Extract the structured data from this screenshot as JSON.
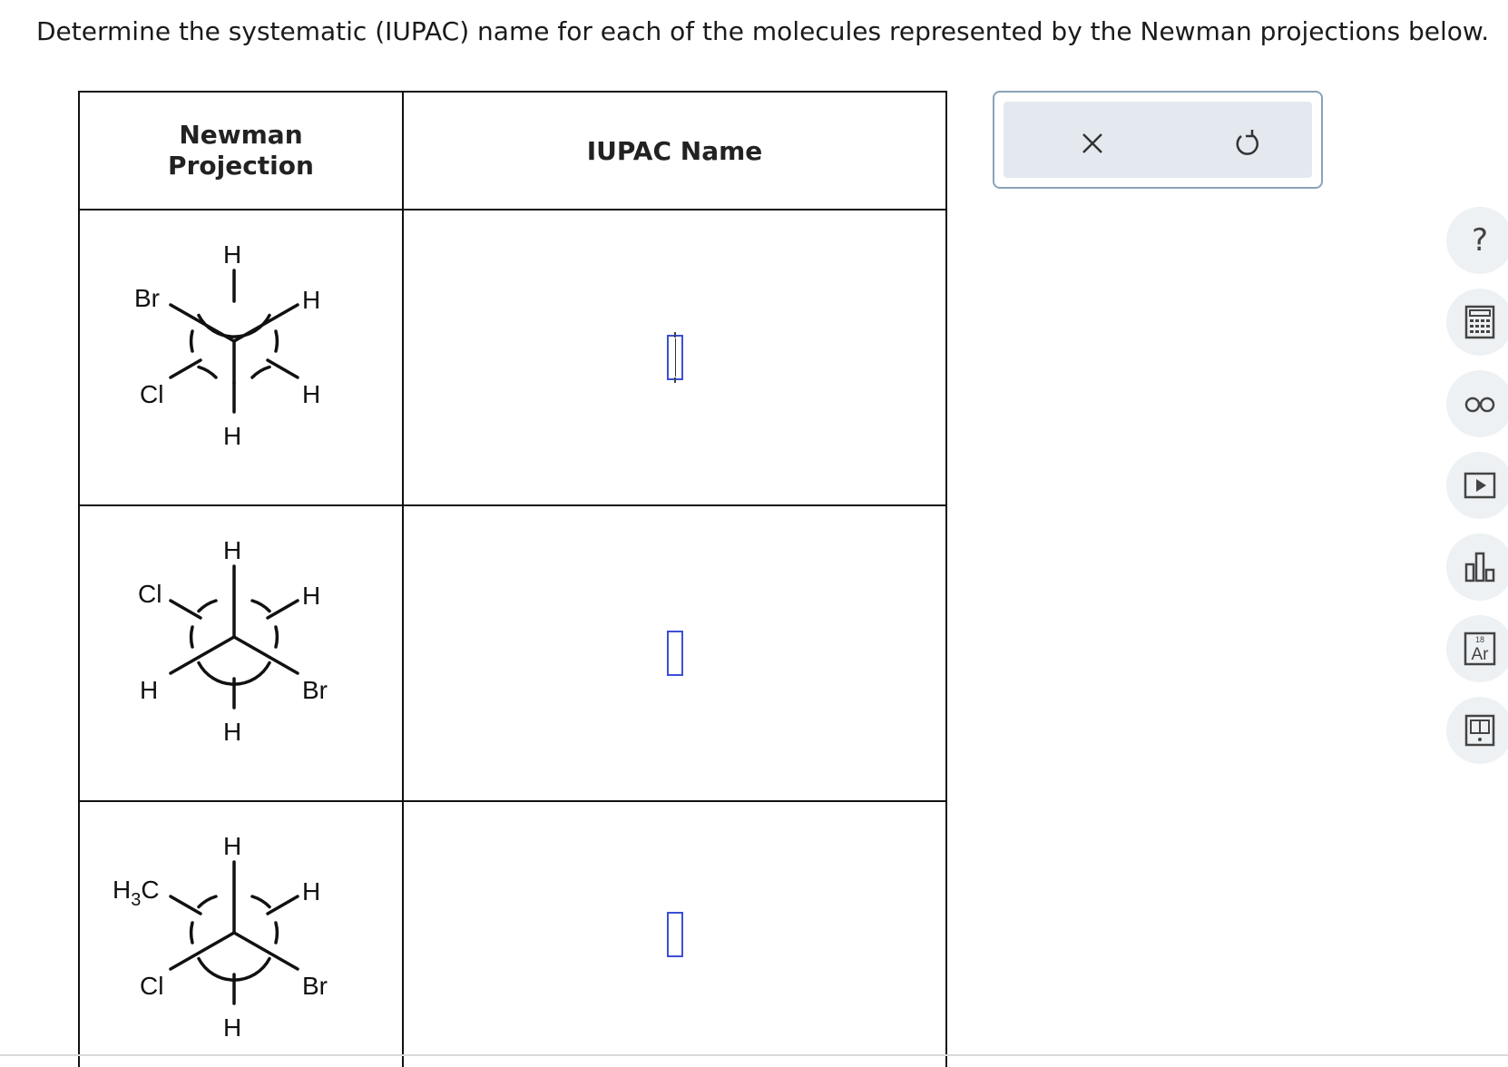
{
  "prompt": "Determine the systematic (IUPAC) name for each of the molecules represented by the Newman projections below.",
  "table": {
    "col1_header_line1": "Newman",
    "col1_header_line2": "Projection",
    "col2_header": "IUPAC Name",
    "rows": [
      {
        "front_top": "H",
        "front_bottom_left": "Cl",
        "front_bottom_right": "H",
        "back_top_left": "Br",
        "back_top_right": "H",
        "back_bottom": "H",
        "name_value": ""
      },
      {
        "front_top": "H",
        "front_bottom_left": "H",
        "front_bottom_right": "Br",
        "back_top_left": "Cl",
        "back_top_right": "H",
        "back_bottom": "H",
        "name_value": ""
      },
      {
        "front_top": "H",
        "front_bottom_left": "Cl",
        "front_bottom_right": "Br",
        "back_top_left_main": "H",
        "back_top_left_sub": "3",
        "back_top_left_tail": "C",
        "back_top_right": "H",
        "back_bottom": "H",
        "name_value": ""
      }
    ]
  },
  "answer_panel": {
    "clear_icon": "close-x-icon",
    "undo_icon": "undo-arrow-icon"
  },
  "tools": {
    "help_glyph": "?",
    "periodic_number": "18",
    "periodic_symbol": "Ar",
    "items": [
      "help-icon",
      "calculator-icon",
      "glasses-icon",
      "video-icon",
      "bar-chart-icon",
      "periodic-table-icon",
      "textbook-icon"
    ]
  }
}
